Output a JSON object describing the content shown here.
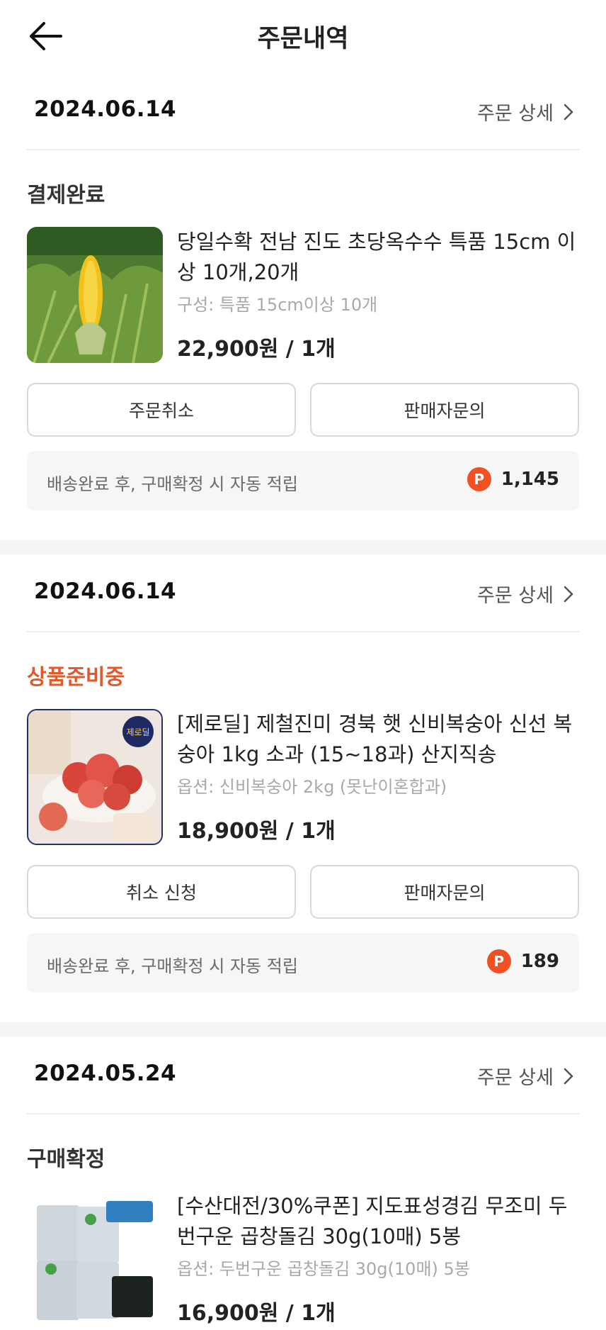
{
  "header": {
    "title": "주문내역"
  },
  "orders": [
    {
      "date": "2024.06.14",
      "detail_label": "주문 상세",
      "status": "결제완료",
      "product_name": "당일수확 전남 진도 초당옥수수 특품 15cm 이상 10개,20개",
      "option": "구성: 특품 15cm이상 10개",
      "price": "22,900원 / 1개",
      "buttons": [
        "주문취소",
        "판매자문의"
      ],
      "points_text": "배송완료 후, 구매확정 시 자동 적립",
      "points_value": "1,145"
    },
    {
      "date": "2024.06.14",
      "detail_label": "주문 상세",
      "status": "상품준비중",
      "product_name": "[제로딜] 제철진미 경북 햇 신비복숭아 신선 복숭아 1kg 소과 (15~18과) 산지직송",
      "option": "옵션: 신비복숭아 2kg (못난이혼합과)",
      "price": "18,900원 / 1개",
      "buttons": [
        "취소 신청",
        "판매자문의"
      ],
      "points_text": "배송완료 후, 구매확정 시 자동 적립",
      "points_value": "189"
    },
    {
      "date": "2024.05.24",
      "detail_label": "주문 상세",
      "status": "구매확정",
      "product_name": "[수산대전/30%쿠폰] 지도표성경김 무조미 두번구운 곱창돌김 30g(10매) 5봉",
      "option": "옵션: 두번구운 곱창돌김 30g(10매) 5봉",
      "price": "16,900원 / 1개"
    }
  ],
  "points_icon_letter": "P",
  "colors": {
    "accent": "#e25a2b",
    "points_icon": "#f05022"
  }
}
